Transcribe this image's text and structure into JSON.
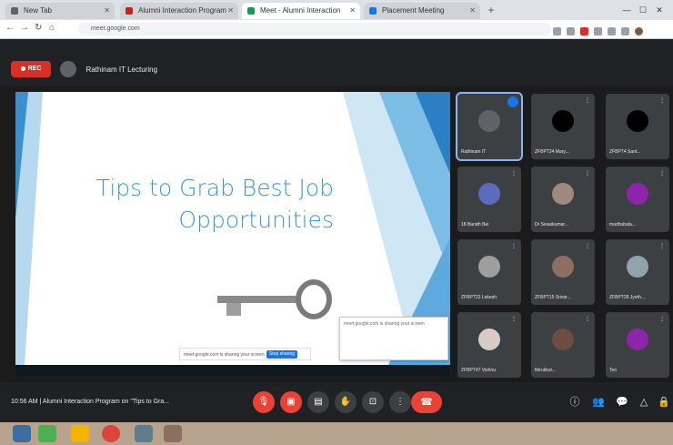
{
  "browser": {
    "tabs": [
      {
        "label": "New Tab",
        "color": "#5f6368"
      },
      {
        "label": "Alumni Interaction Program",
        "color": "#c5221f"
      },
      {
        "label": "Meet - Alumni Interaction",
        "color": "#0f9d58"
      },
      {
        "label": "Placement Meeting",
        "color": "#1a73e8"
      }
    ],
    "url": "meet.google.com"
  },
  "meeting": {
    "rec_label": "REC",
    "name": "Rathinam IT Lecturing",
    "slide_title_line1": "Tips to Grab Best Job",
    "slide_title_line2": "Opportunities",
    "share_notice": "meet.google.com is sharing your screen",
    "stop_sharing_label": "Stop sharing",
    "time": "10:56 AM",
    "title": "Alumni Interaction Program on \"Tips to Gra..."
  },
  "participants": [
    {
      "name": "Rathinam IT",
      "avatar_color": "#5f6368",
      "active": true
    },
    {
      "name": "ZFBPT24 Mary...",
      "avatar_color": "#000000"
    },
    {
      "name": "ZFBPT4 Sant...",
      "avatar_color": "#000000"
    },
    {
      "name": "18 Barath Bei",
      "avatar_color": "#5c6bc0"
    },
    {
      "name": "Dr Sivaakumar...",
      "avatar_color": "#a1887f"
    },
    {
      "name": "madhubala...",
      "avatar_color": "#8e24aa"
    },
    {
      "name": "ZFBPT23 Lokesh",
      "avatar_color": "#9e9e9e"
    },
    {
      "name": "ZFBPT15 Srivar...",
      "avatar_color": "#8d6e63"
    },
    {
      "name": "ZFBPT39 Jyoth...",
      "avatar_color": "#90a4ae"
    },
    {
      "name": "ZFBPT47 Vishnu",
      "avatar_color": "#d7ccc8"
    },
    {
      "name": "thirukkur...",
      "avatar_color": "#6d4c41"
    },
    {
      "name": "Teo",
      "avatar_color": "#8e24aa"
    }
  ],
  "icons": {
    "back": "arrow-left-icon",
    "forward": "arrow-right-icon",
    "reload": "reload-icon",
    "mic": "mic-icon",
    "camera": "camera-icon",
    "hangup": "hangup-icon"
  }
}
